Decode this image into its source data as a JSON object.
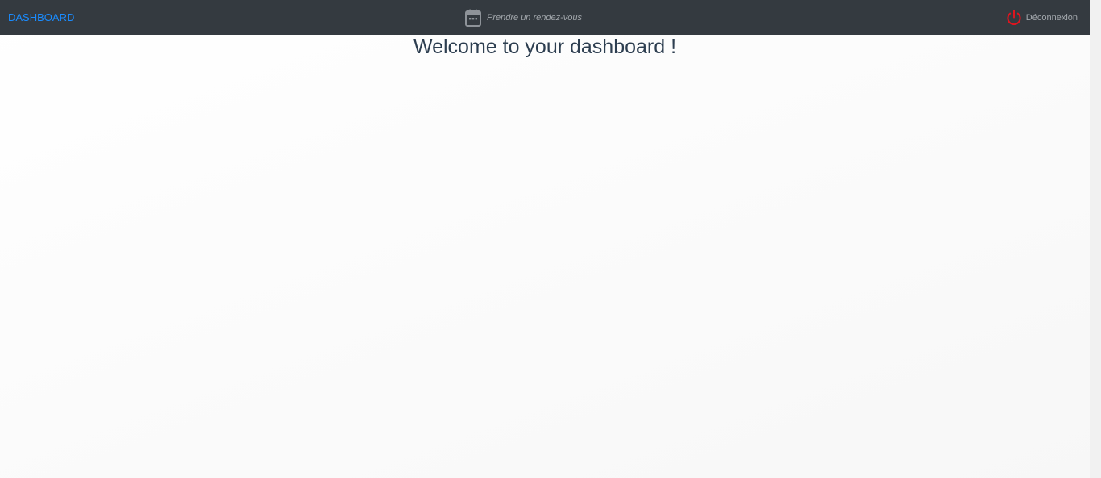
{
  "navbar": {
    "brand_label": "DASHBOARD",
    "appointment": {
      "icon": "calendar-icon",
      "label": "Prendre un rendez-vous"
    },
    "logout": {
      "icon": "power-icon",
      "label": "Déconnexion",
      "icon_color": "#e0141e"
    },
    "background_color": "#343a40",
    "brand_color": "#1a8cff"
  },
  "main": {
    "title": "Welcome to your dashboard !"
  }
}
